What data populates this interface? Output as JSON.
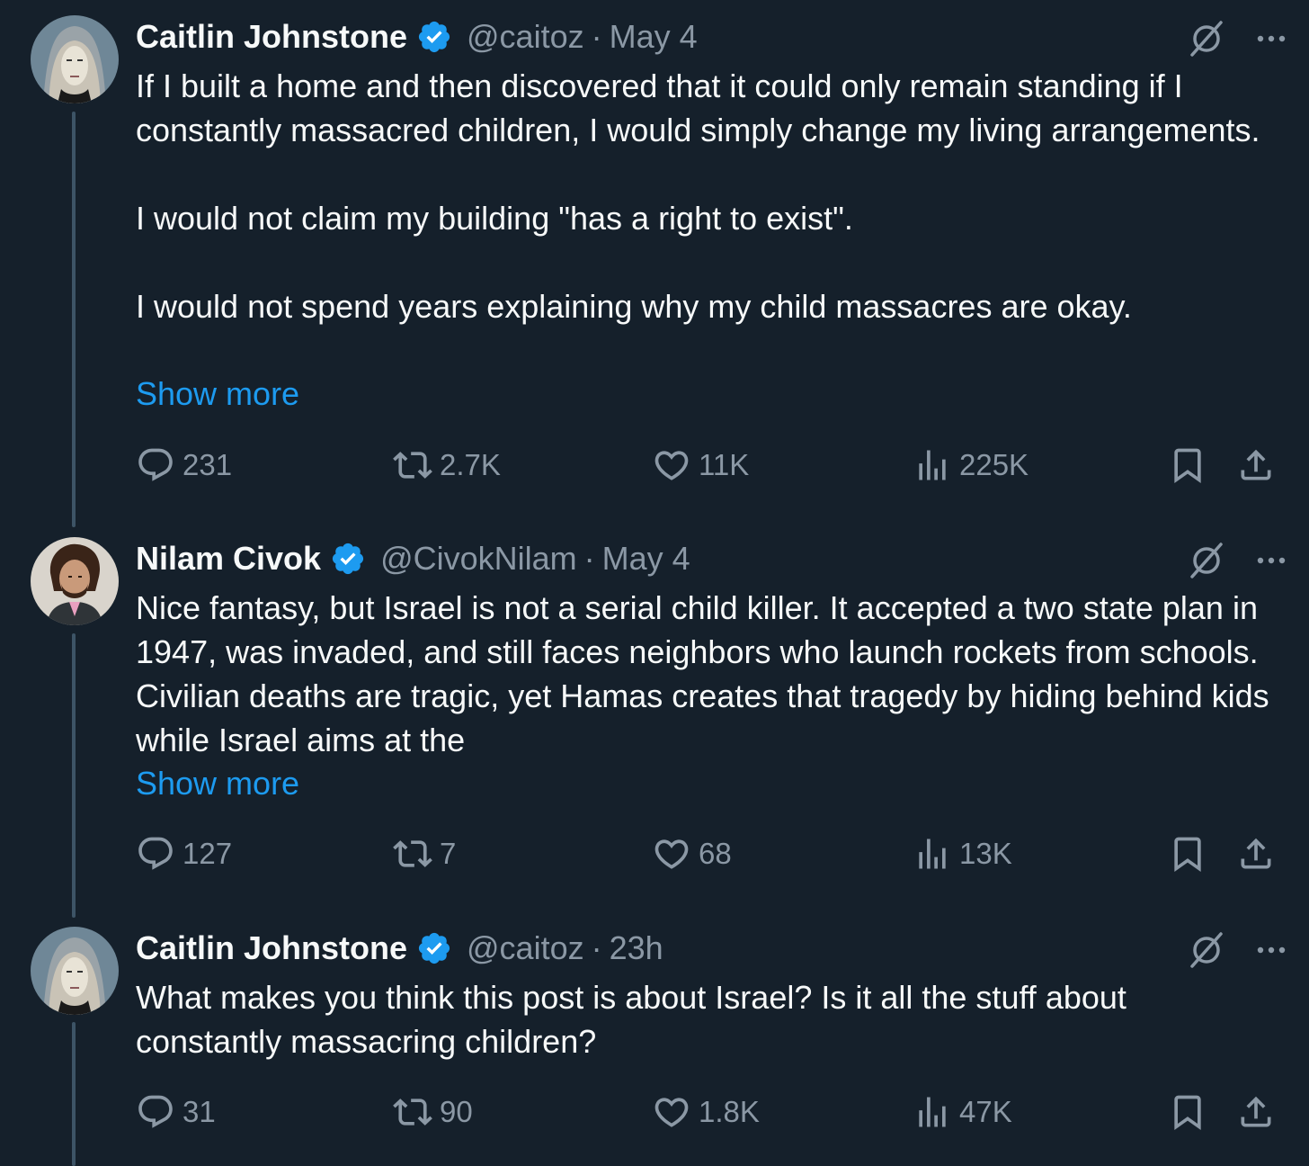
{
  "tweets": [
    {
      "name": "Caitlin Johnstone",
      "handle": "@caitoz",
      "separator": "·",
      "date": "May 4",
      "paragraphs": [
        "If I built a home and then discovered that it could only remain standing if I constantly massacred children, I would simply change my living arrangements.",
        "",
        "I would not claim my building \"has a right to exist\".",
        "",
        "I would not spend years explaining why my child massacres are okay."
      ],
      "show_more": "Show more",
      "replies": "231",
      "retweets": "2.7K",
      "likes": "11K",
      "views": "225K"
    },
    {
      "name": "Nilam Civok",
      "handle": "@CivokNilam",
      "separator": "·",
      "date": "May 4",
      "paragraphs": [
        "Nice fantasy, but Israel is not a serial child killer. It accepted a two state plan in 1947, was invaded, and still faces neighbors who launch rockets from schools. Civilian deaths are tragic, yet Hamas creates that tragedy by hiding behind kids while Israel aims at the"
      ],
      "show_more": "Show more",
      "replies": "127",
      "retweets": "7",
      "likes": "68",
      "views": "13K"
    },
    {
      "name": "Caitlin Johnstone",
      "handle": "@caitoz",
      "separator": "·",
      "date": "23h",
      "paragraphs": [
        "What makes you think this post is about Israel? Is it all the stuff about constantly massacring children?"
      ],
      "replies": "31",
      "retweets": "90",
      "likes": "1.8K",
      "views": "47K"
    }
  ],
  "icons": {
    "verified": "verified-badge-icon",
    "grok": "grok-icon",
    "more": "more-icon",
    "reply": "reply-icon",
    "retweet": "retweet-icon",
    "like": "like-icon",
    "views": "views-icon",
    "bookmark": "bookmark-icon",
    "share": "share-icon"
  },
  "colors": {
    "background": "#15202b",
    "text": "#f7f9f9",
    "secondary": "#8b98a5",
    "accent": "#1d9bf0",
    "thread_line": "#3d5466"
  }
}
